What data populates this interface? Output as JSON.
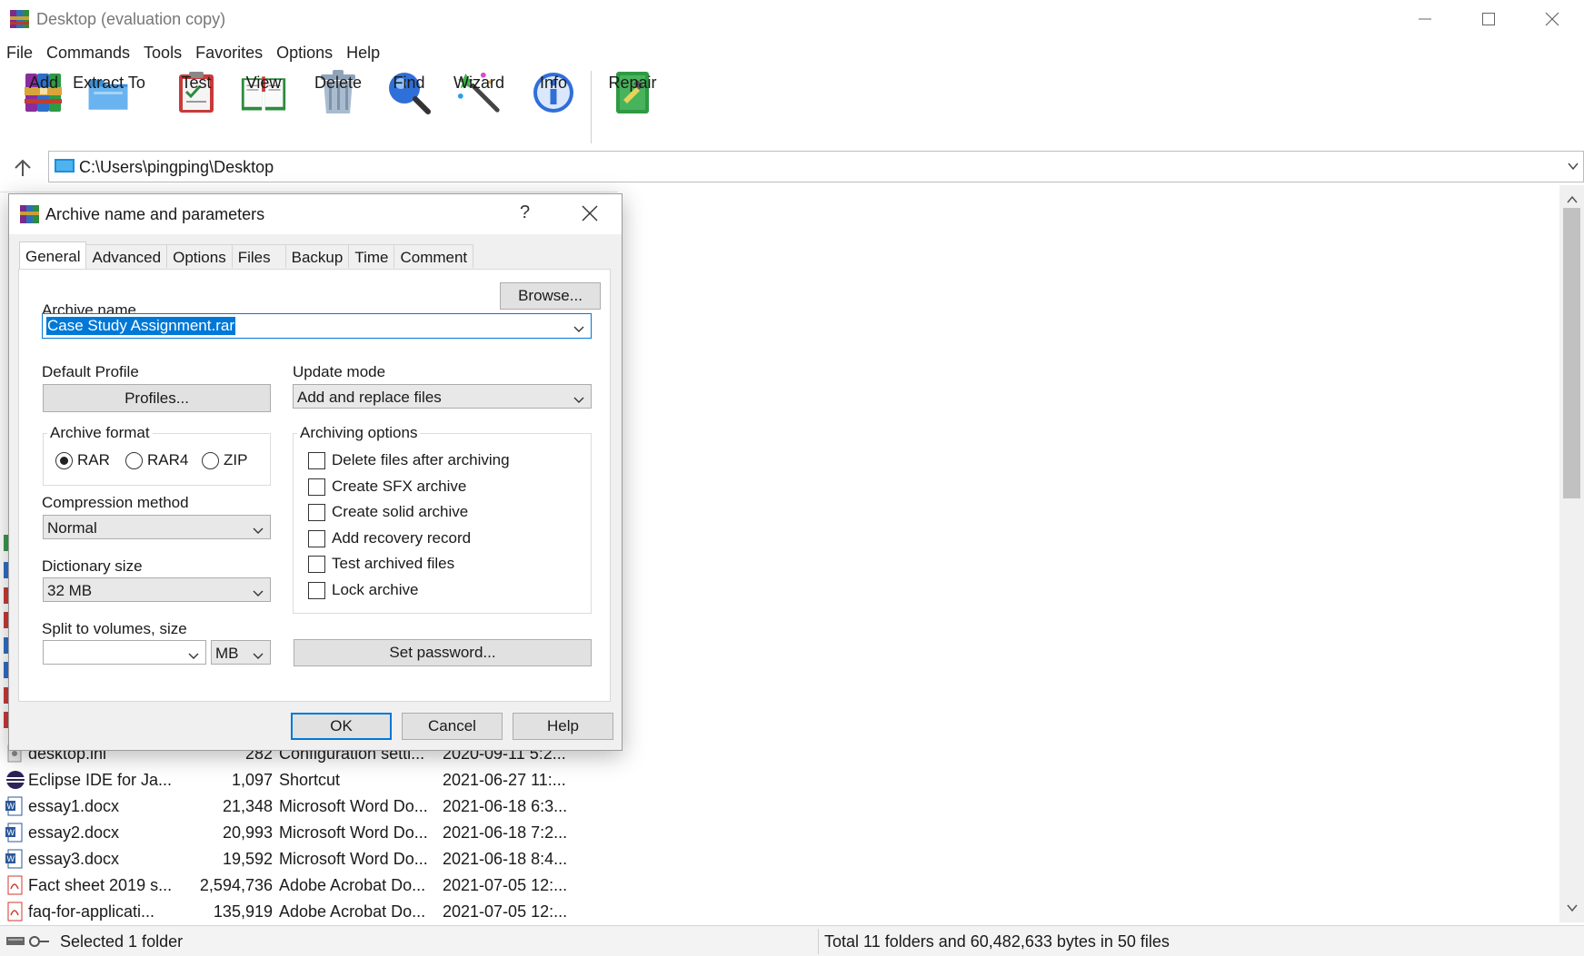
{
  "window": {
    "title": "Desktop (evaluation copy)"
  },
  "menu": [
    "File",
    "Commands",
    "Tools",
    "Favorites",
    "Options",
    "Help"
  ],
  "toolbar": [
    {
      "label": "Add",
      "icon": "add-archive-icon"
    },
    {
      "label": "Extract To",
      "icon": "extract-folder-icon"
    },
    {
      "label": "Test",
      "icon": "test-clipboard-icon"
    },
    {
      "label": "View",
      "icon": "view-book-icon"
    },
    {
      "label": "Delete",
      "icon": "delete-trash-icon"
    },
    {
      "label": "Find",
      "icon": "find-magnifier-icon"
    },
    {
      "label": "Wizard",
      "icon": "wizard-wand-icon"
    },
    {
      "label": "Info",
      "icon": "info-icon"
    },
    {
      "label": "Repair",
      "icon": "repair-kit-icon"
    }
  ],
  "address": {
    "path": "C:\\Users\\pingping\\Desktop"
  },
  "files": [
    {
      "name": "desktop.ini",
      "size": "282",
      "type": "Configuration setti...",
      "modified": "2020-09-11 5:2..."
    },
    {
      "name": "Eclipse IDE for Ja...",
      "size": "1,097",
      "type": "Shortcut",
      "modified": "2021-06-27 11:..."
    },
    {
      "name": "essay1.docx",
      "size": "21,348",
      "type": "Microsoft Word Do...",
      "modified": "2021-06-18 6:3..."
    },
    {
      "name": "essay2.docx",
      "size": "20,993",
      "type": "Microsoft Word Do...",
      "modified": "2021-06-18 7:2..."
    },
    {
      "name": "essay3.docx",
      "size": "19,592",
      "type": "Microsoft Word Do...",
      "modified": "2021-06-18 8:4..."
    },
    {
      "name": "Fact sheet 2019 s...",
      "size": "2,594,736",
      "type": "Adobe Acrobat Do...",
      "modified": "2021-07-05 12:..."
    },
    {
      "name": "faq-for-applicati...",
      "size": "135,919",
      "type": "Adobe Acrobat Do...",
      "modified": "2021-07-05 12:..."
    }
  ],
  "status": {
    "left": "Selected 1 folder",
    "right": "Total 11 folders and 60,482,633 bytes in 50 files"
  },
  "dialog": {
    "title": "Archive name and parameters",
    "help_glyph": "?",
    "tabs": [
      "General",
      "Advanced",
      "Options",
      "Files",
      "Backup",
      "Time",
      "Comment"
    ],
    "archive_name_label": "Archive name",
    "browse_label": "Browse...",
    "archive_name_value": "Case Study Assignment.rar",
    "default_profile_label": "Default Profile",
    "profiles_label": "Profiles...",
    "update_mode_label": "Update mode",
    "update_mode_value": "Add and replace files",
    "archive_format_label": "Archive format",
    "formats": [
      "RAR",
      "RAR4",
      "ZIP"
    ],
    "selected_format": "RAR",
    "compression_label": "Compression method",
    "compression_value": "Normal",
    "dictionary_label": "Dictionary size",
    "dictionary_value": "32 MB",
    "split_label": "Split to volumes, size",
    "split_value": "",
    "split_unit": "MB",
    "archiving_options_label": "Archiving options",
    "options": [
      {
        "label": "Delete files after archiving",
        "checked": false
      },
      {
        "label": "Create SFX archive",
        "checked": false
      },
      {
        "label": "Create solid archive",
        "checked": false
      },
      {
        "label": "Add recovery record",
        "checked": false
      },
      {
        "label": "Test archived files",
        "checked": false
      },
      {
        "label": "Lock archive",
        "checked": false
      }
    ],
    "set_password_label": "Set password...",
    "ok_label": "OK",
    "cancel_label": "Cancel",
    "help_label": "Help"
  },
  "colors": {
    "accent": "#0078d7",
    "dialog_bg": "#f0f0f0",
    "button_bg": "#e1e1e1"
  }
}
